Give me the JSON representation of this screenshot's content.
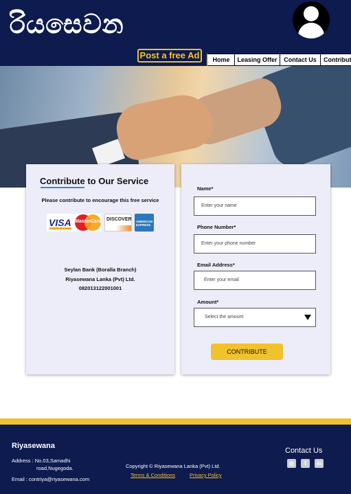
{
  "header": {
    "logo_text": "රියසෙවන",
    "post_ad_label": "Post a free Ad",
    "nav_items": [
      {
        "label": "Home"
      },
      {
        "label": "Leasing Offer"
      },
      {
        "label": "Contact Us"
      },
      {
        "label": "Contribute"
      }
    ]
  },
  "contribute": {
    "title": "Contribute to Our Service",
    "subtitle": "Please contribute to encourage this free service",
    "card_brands": {
      "visa": "VISA",
      "mastercard": "MasterCard",
      "discover": "DISCOVER",
      "amex": "AMERICAN EXPRESS"
    },
    "bank": {
      "branch": "Seylan Bank (Boralla Branch)",
      "account_name": "Riyasewana Lanka (Pvt) Ltd.",
      "account_number": "082013122001001"
    }
  },
  "form": {
    "name_label": "Name*",
    "name_placeholder": "Enter your name",
    "phone_label": "Phone Number*",
    "phone_placeholder": "Enter your phone number",
    "email_label": "Email Address*",
    "email_placeholder": "Enter your email",
    "amount_label": "Amount*",
    "amount_placeholder": "Select the amount",
    "submit_label": "CONTRIBUTE"
  },
  "footer": {
    "brand": "Riyasewana",
    "address_label": "Address : No.03,Samadhi",
    "address_line2": "road,Nugegoda.",
    "email_label": "Email : contriya@riyasewana.com",
    "copyright": "Copyright © Riyasewana Lanka (Pvt) Ltd.",
    "terms": "Terms & Conditions",
    "privacy": "Privacy Policy",
    "contact_heading": "Contact Us"
  },
  "colors": {
    "header_bg": "#0e1b4f",
    "accent_yellow": "#f2c22c",
    "card_bg": "#ecedf9"
  },
  "icons": [
    "avatar-icon",
    "instagram-icon",
    "facebook-icon",
    "linkedin-icon",
    "chevron-down-icon"
  ]
}
